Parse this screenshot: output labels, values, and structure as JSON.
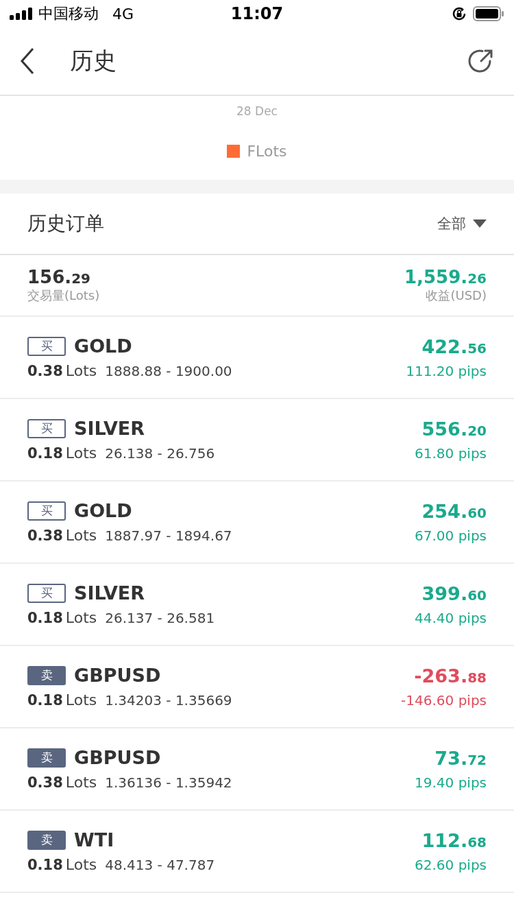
{
  "status_bar": {
    "carrier": "中国移动",
    "network": "4G",
    "time": "11:07"
  },
  "nav": {
    "title": "历史"
  },
  "chart": {
    "x_label": "28 Dec",
    "legend": [
      {
        "label": "FLots",
        "color": "#ff6b35"
      }
    ]
  },
  "orders_header": {
    "title": "历史订单",
    "filter": "全部"
  },
  "summary": {
    "volume": "156.29",
    "volume_label": "交易量(Lots)",
    "profit": "1,559.26",
    "profit_label": "收益(USD)"
  },
  "orders": [
    {
      "side": {
        "kind": "buy",
        "label": "买"
      },
      "symbol": "GOLD",
      "lots": "0.38",
      "lots_unit": "Lots",
      "range": "1888.88 - 1900.00",
      "pnl": {
        "kind": "gain",
        "profit": "422.56",
        "pips": "111.20 pips"
      }
    },
    {
      "side": {
        "kind": "buy",
        "label": "买"
      },
      "symbol": "SILVER",
      "lots": "0.18",
      "lots_unit": "Lots",
      "range": "26.138 - 26.756",
      "pnl": {
        "kind": "gain",
        "profit": "556.20",
        "pips": "61.80 pips"
      }
    },
    {
      "side": {
        "kind": "buy",
        "label": "买"
      },
      "symbol": "GOLD",
      "lots": "0.38",
      "lots_unit": "Lots",
      "range": "1887.97 - 1894.67",
      "pnl": {
        "kind": "gain",
        "profit": "254.60",
        "pips": "67.00 pips"
      }
    },
    {
      "side": {
        "kind": "buy",
        "label": "买"
      },
      "symbol": "SILVER",
      "lots": "0.18",
      "lots_unit": "Lots",
      "range": "26.137 - 26.581",
      "pnl": {
        "kind": "gain",
        "profit": "399.60",
        "pips": "44.40 pips"
      }
    },
    {
      "side": {
        "kind": "sell",
        "label": "卖"
      },
      "symbol": "GBPUSD",
      "lots": "0.18",
      "lots_unit": "Lots",
      "range": "1.34203 - 1.35669",
      "pnl": {
        "kind": "loss",
        "profit": "-263.88",
        "pips": "-146.60 pips"
      }
    },
    {
      "side": {
        "kind": "sell",
        "label": "卖"
      },
      "symbol": "GBPUSD",
      "lots": "0.38",
      "lots_unit": "Lots",
      "range": "1.36136 - 1.35942",
      "pnl": {
        "kind": "gain",
        "profit": "73.72",
        "pips": "19.40 pips"
      }
    },
    {
      "side": {
        "kind": "sell",
        "label": "卖"
      },
      "symbol": "WTI",
      "lots": "0.18",
      "lots_unit": "Lots",
      "range": "48.413 - 47.787",
      "pnl": {
        "kind": "gain",
        "profit": "112.68",
        "pips": "62.60 pips"
      }
    }
  ]
}
